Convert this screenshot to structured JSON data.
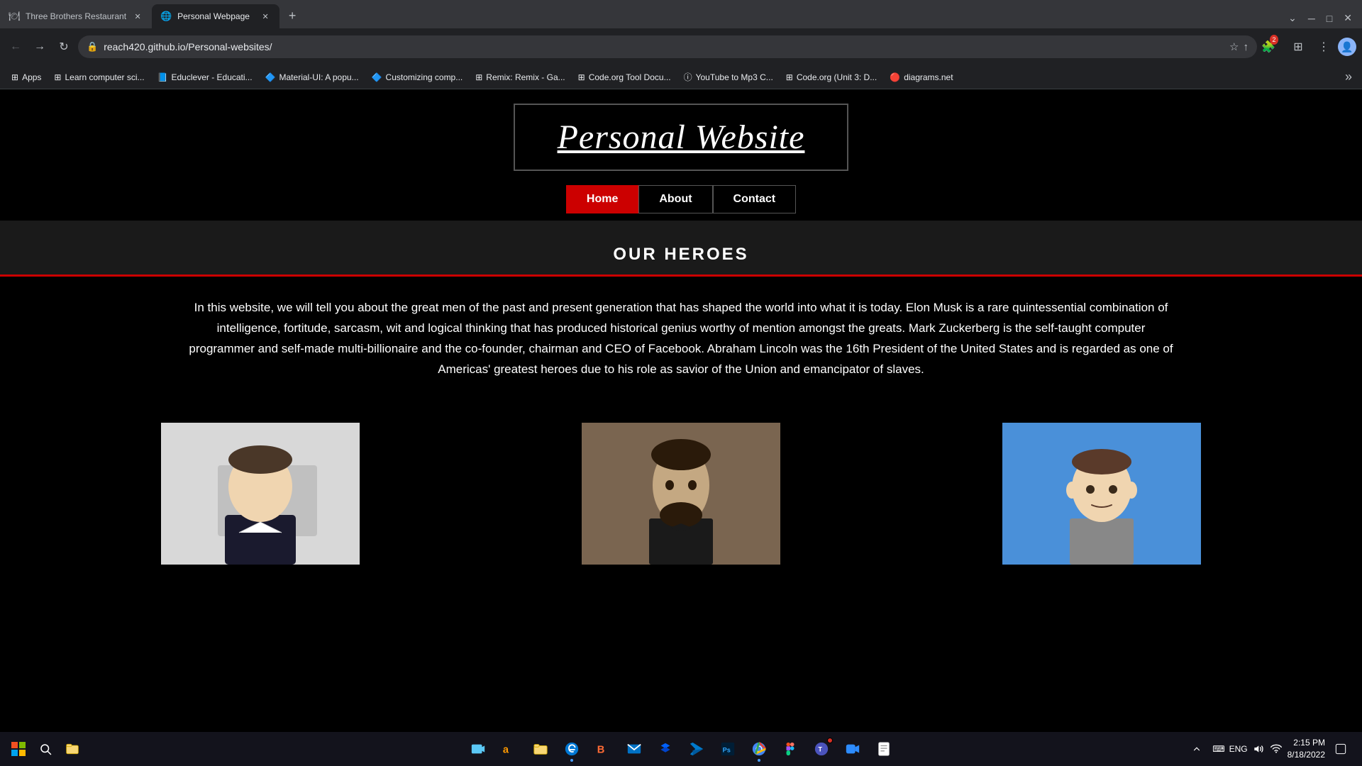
{
  "browser": {
    "tabs": [
      {
        "id": "tab1",
        "title": "Three Brothers Restaurant",
        "favicon": "🍽",
        "active": false
      },
      {
        "id": "tab2",
        "title": "Personal Webpage",
        "favicon": "🌐",
        "active": true
      }
    ],
    "url": "reach420.github.io/Personal-websites/",
    "bookmarks": [
      {
        "label": "Apps",
        "icon": "⊞"
      },
      {
        "label": "Learn computer sci...",
        "icon": "⊞"
      },
      {
        "label": "Educlever - Educati...",
        "icon": "📘"
      },
      {
        "label": "Material-UI: A popu...",
        "icon": "🔷"
      },
      {
        "label": "Customizing comp...",
        "icon": "🔷"
      },
      {
        "label": "Remix: Remix - Ga...",
        "icon": "⊞"
      },
      {
        "label": "Code.org Tool Docu...",
        "icon": "⊞"
      },
      {
        "label": "YouTube to Mp3 C...",
        "icon": "ⓘ"
      },
      {
        "label": "Code.org (Unit 3: D...",
        "icon": "⊞"
      },
      {
        "label": "diagrams.net",
        "icon": "🔴"
      }
    ]
  },
  "site": {
    "title": "Personal Website",
    "nav": {
      "items": [
        {
          "label": "Home",
          "active": true
        },
        {
          "label": "About",
          "active": false
        },
        {
          "label": "Contact",
          "active": false
        }
      ]
    },
    "heroes_title": "OUR HEROES",
    "description": "In this website, we will tell you about the great men of the past and present generation that has shaped the world into what it is today. Elon Musk is a rare quintessential combination of intelligence, fortitude, sarcasm, wit and logical thinking that has produced historical genius worthy of mention amongst the greats. Mark Zuckerberg is the self-taught computer programmer and self-made multi-billionaire and the co-founder, chairman and CEO of Facebook. Abraham Lincoln was the 16th President of the United States and is regarded as one of Americas' greatest heroes due to his role as savior of the Union and emancipator of slaves.",
    "heroes": [
      {
        "name": "Elon Musk",
        "bg": "elon"
      },
      {
        "name": "Abraham Lincoln",
        "bg": "lincoln"
      },
      {
        "name": "Mark Zuckerberg",
        "bg": "zuckerberg"
      }
    ]
  },
  "taskbar": {
    "time": "2:15 PM",
    "date": "8/18/2022",
    "language": "ENG",
    "apps": [
      {
        "icon": "⊞",
        "name": "start"
      },
      {
        "icon": "🔍",
        "name": "search"
      },
      {
        "icon": "🗂",
        "name": "file-explorer"
      },
      {
        "icon": "🎥",
        "name": "video"
      },
      {
        "icon": "📦",
        "name": "amazon"
      },
      {
        "icon": "📁",
        "name": "folder"
      },
      {
        "icon": "🌐",
        "name": "edge"
      },
      {
        "icon": "B",
        "name": "brave"
      },
      {
        "icon": "📧",
        "name": "mail"
      },
      {
        "icon": "📤",
        "name": "dropbox"
      },
      {
        "icon": "💻",
        "name": "vscode"
      },
      {
        "icon": "🖌",
        "name": "photoshop"
      },
      {
        "icon": "🌐",
        "name": "chrome"
      },
      {
        "icon": "🎨",
        "name": "figma"
      },
      {
        "icon": "🔵",
        "name": "teams"
      },
      {
        "icon": "📹",
        "name": "zoom"
      },
      {
        "icon": "📝",
        "name": "notepad"
      }
    ]
  }
}
